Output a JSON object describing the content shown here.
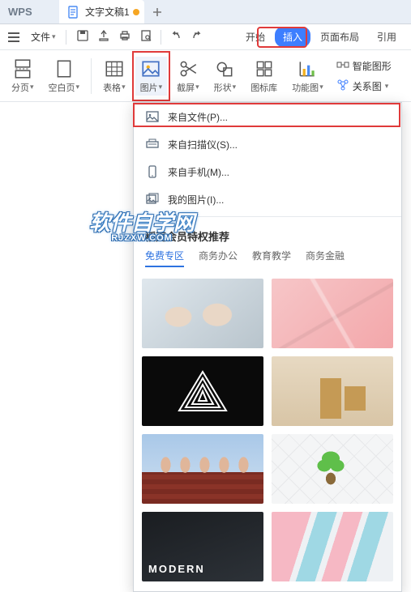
{
  "titlebar": {
    "app": "WPS",
    "doc": "文字文稿1"
  },
  "menubar": {
    "file": "文件"
  },
  "ribbon_tabs": {
    "start": "开始",
    "insert": "插入",
    "layout": "页面布局",
    "ref": "引用"
  },
  "ribbon": {
    "paging": "分页",
    "blank": "空白页",
    "table": "表格",
    "picture": "图片",
    "screenshot": "截屏",
    "shape": "形状",
    "iconlib": "图标库",
    "funcfig": "功能图",
    "smart": "智能图形",
    "relation": "关系图"
  },
  "menu": {
    "from_file": "来自文件(P)...",
    "from_scanner": "来自扫描仪(S)...",
    "from_phone": "来自手机(M)...",
    "my_pictures": "我的图片(I)..."
  },
  "rec": {
    "title": "稻壳会员特权推荐",
    "cats": [
      "免费专区",
      "商务办公",
      "教育教学",
      "商务金融"
    ]
  },
  "thumbs": {
    "modern": "MODERN"
  },
  "watermark": {
    "cn": "软件自学网",
    "en": "RJZXW.COM"
  }
}
